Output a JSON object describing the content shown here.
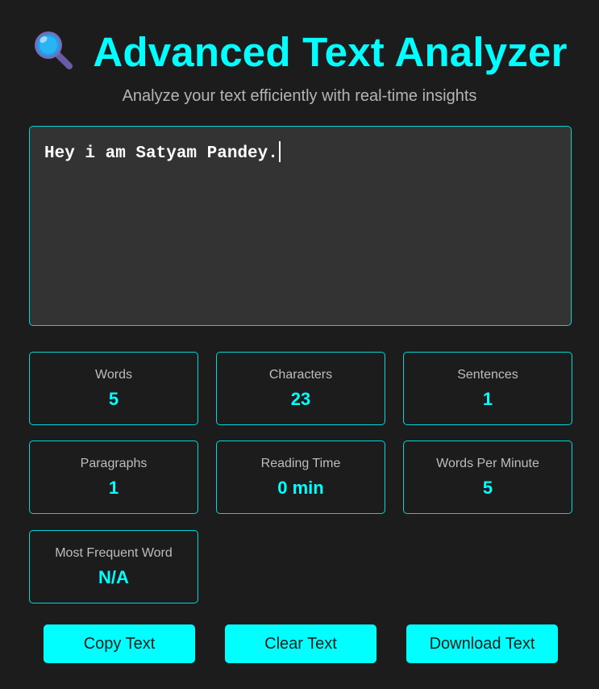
{
  "header": {
    "icon": "magnifying-glass-icon",
    "title": "Advanced Text Analyzer",
    "subtitle": "Analyze your text efficiently with real-time insights"
  },
  "editor": {
    "value": "Hey i am Satyam Pandey."
  },
  "stats": {
    "words": {
      "label": "Words",
      "value": "5"
    },
    "characters": {
      "label": "Characters",
      "value": "23"
    },
    "sentences": {
      "label": "Sentences",
      "value": "1"
    },
    "paragraphs": {
      "label": "Paragraphs",
      "value": "1"
    },
    "reading_time": {
      "label": "Reading Time",
      "value": "0 min"
    },
    "words_per_minute": {
      "label": "Words Per Minute",
      "value": "5"
    },
    "most_frequent_word": {
      "label": "Most Frequent Word",
      "value": "N/A"
    }
  },
  "actions": {
    "copy_label": "Copy Text",
    "clear_label": "Clear Text",
    "download_label": "Download Text"
  },
  "colors": {
    "accent": "#00ffff",
    "background": "#1c1c1c",
    "editor_background": "#333333",
    "border": "#00d7d7"
  }
}
